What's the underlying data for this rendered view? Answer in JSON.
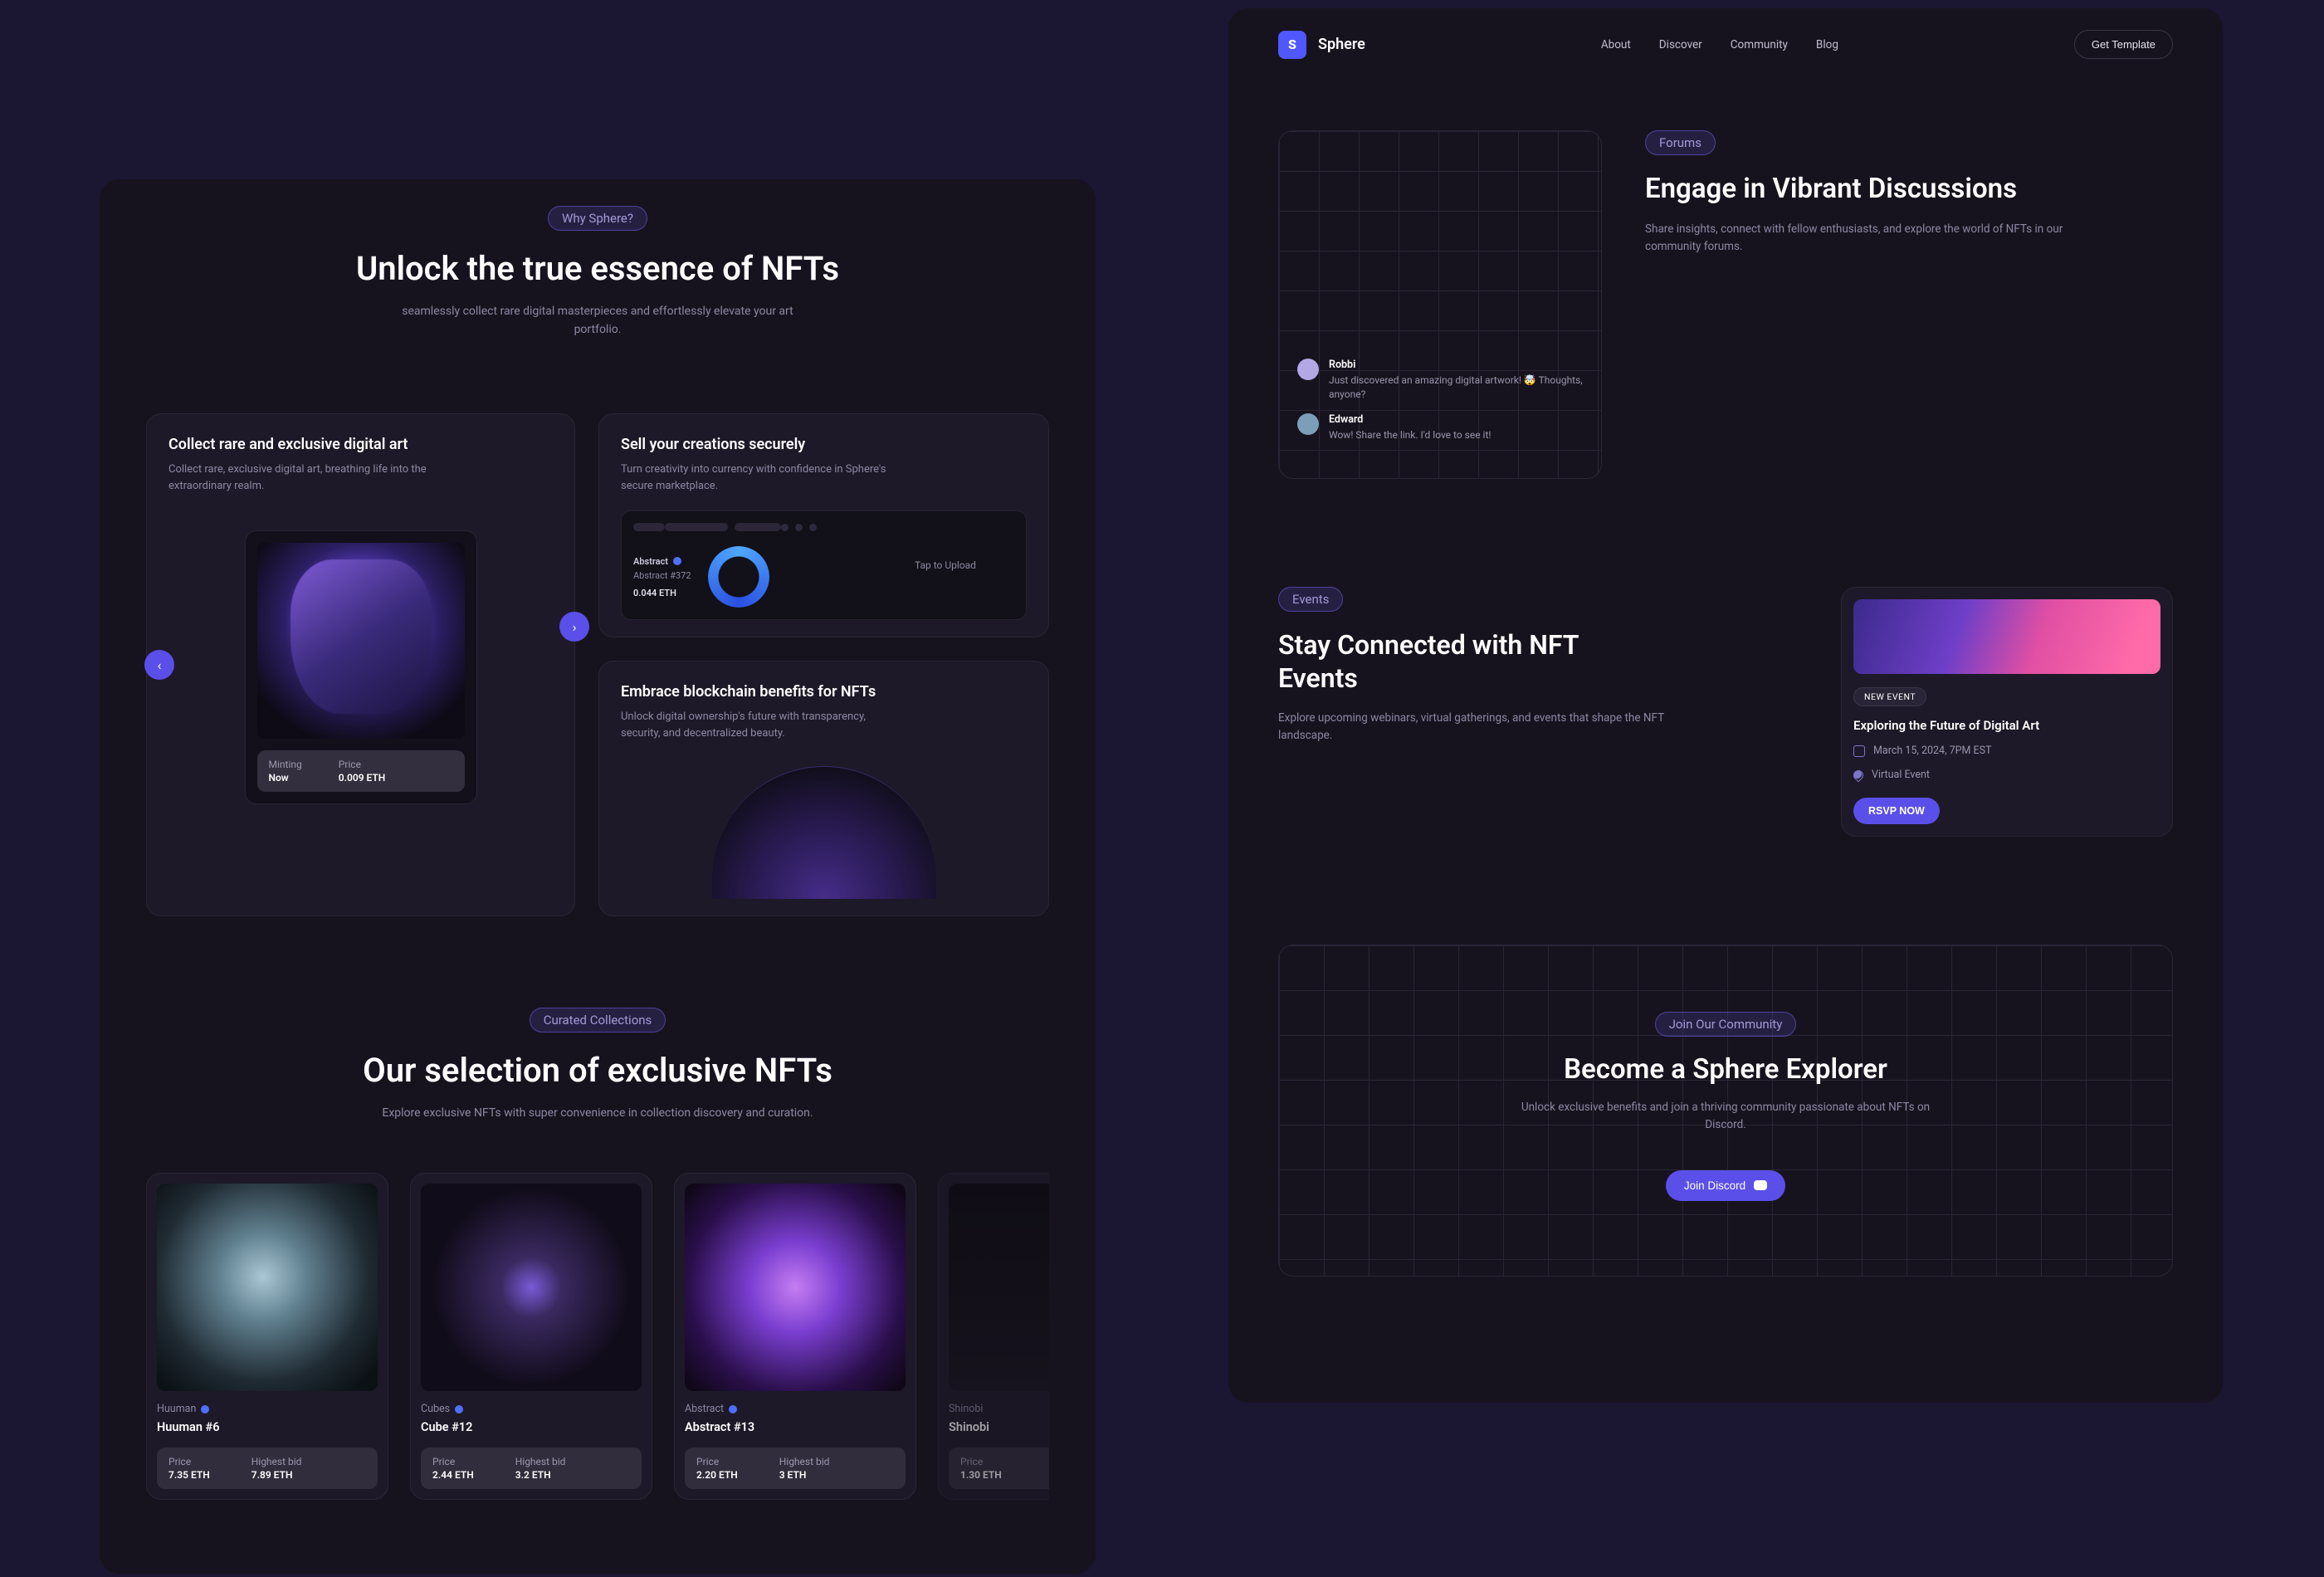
{
  "left": {
    "why_pill": "Why Sphere?",
    "why_title": "Unlock the true essence of NFTs",
    "why_sub": "seamlessly collect rare digital masterpieces and effortlessly elevate your art portfolio.",
    "feat_collect": {
      "title": "Collect rare and exclusive digital art",
      "desc": "Collect rare, exclusive digital art, breathing life into the extraordinary realm.",
      "minting_label": "Minting",
      "minting_value": "Now",
      "price_label": "Price",
      "price_value": "0.009 ETH"
    },
    "feat_sell": {
      "title": "Sell your creations securely",
      "desc": "Turn creativity into currency with confidence in Sphere's secure marketplace.",
      "card_name": "Abstract",
      "card_id": "Abstract #372",
      "card_price": "0.044 ETH",
      "upload_hint": "Tap to Upload"
    },
    "feat_embrace": {
      "title": "Embrace blockchain benefits for NFTs",
      "desc": "Unlock digital ownership's future with transparency, security, and decentralized beauty."
    },
    "curated_pill": "Curated Collections",
    "curated_title": "Our selection of exclusive NFTs",
    "curated_sub": "Explore exclusive NFTs with super convenience in collection discovery and curation.",
    "cards": [
      {
        "collection": "Huuman",
        "name": "Huuman #6",
        "price_label": "Price",
        "price": "7.35 ETH",
        "bid_label": "Highest bid",
        "bid": "7.89 ETH"
      },
      {
        "collection": "Cubes",
        "name": "Cube #12",
        "price_label": "Price",
        "price": "2.44 ETH",
        "bid_label": "Highest bid",
        "bid": "3.2 ETH"
      },
      {
        "collection": "Abstract",
        "name": "Abstract #13",
        "price_label": "Price",
        "price": "2.20 ETH",
        "bid_label": "Highest bid",
        "bid": "3 ETH"
      },
      {
        "collection": "Shinobi",
        "name": "Shinobi",
        "price_label": "Price",
        "price": "1.30 ETH",
        "bid_label": "",
        "bid": ""
      }
    ]
  },
  "right": {
    "brand": "Sphere",
    "nav": {
      "about": "About",
      "discover": "Discover",
      "community": "Community",
      "blog": "Blog"
    },
    "get_template": "Get Template",
    "forums": {
      "pill": "Forums",
      "title": "Engage in Vibrant Discussions",
      "sub": "Share insights, connect with fellow enthusiasts, and explore the world of NFTs in our community forums.",
      "msg1_name": "Robbi",
      "msg1_text": "Just discovered an amazing digital artwork! 🤯 Thoughts, anyone?",
      "msg2_name": "Edward",
      "msg2_text": "Wow! Share the link. I'd love to see it!"
    },
    "events": {
      "pill": "Events",
      "title": "Stay Connected with NFT Events",
      "sub": "Explore upcoming webinars, virtual gatherings, and events that shape the NFT landscape.",
      "badge": "NEW EVENT",
      "event_title": "Exploring the Future of Digital Art",
      "date": "March 15, 2024, 7PM EST",
      "location": "Virtual Event",
      "rsvp": "RSVP NOW"
    },
    "explorer": {
      "pill": "Join Our Community",
      "title": "Become a Sphere Explorer",
      "sub": "Unlock exclusive benefits and join a thriving community passionate about NFTs on Discord.",
      "cta": "Join Discord"
    }
  }
}
